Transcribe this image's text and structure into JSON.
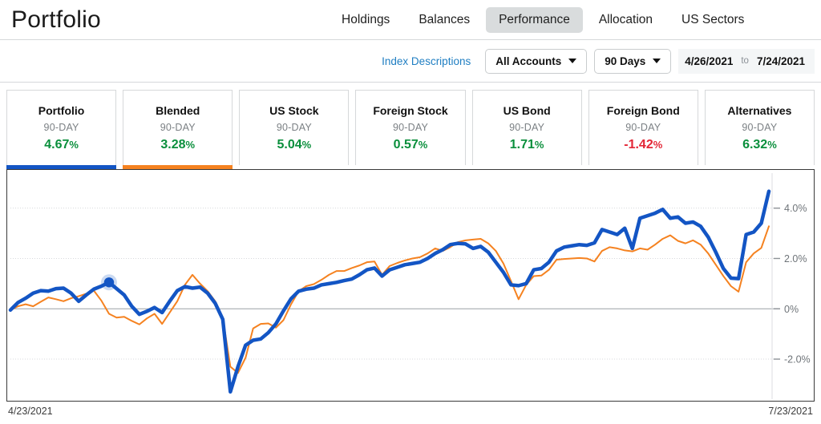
{
  "header": {
    "title": "Portfolio",
    "tabs": [
      {
        "label": "Holdings",
        "active": false
      },
      {
        "label": "Balances",
        "active": false
      },
      {
        "label": "Performance",
        "active": true
      },
      {
        "label": "Allocation",
        "active": false
      },
      {
        "label": "US Sectors",
        "active": false
      }
    ]
  },
  "toolbar": {
    "index_descriptions": "Index Descriptions",
    "accounts_filter": "All Accounts",
    "period_filter": "90 Days",
    "date_from": "4/26/2021",
    "date_to_label": "to",
    "date_to": "7/24/2021"
  },
  "cards": [
    {
      "title": "Portfolio",
      "period": "90-DAY",
      "value": "4.67",
      "unit": "%",
      "sign": "pos",
      "selected": true,
      "color": "#1355c4"
    },
    {
      "title": "Blended",
      "period": "90-DAY",
      "value": "3.28",
      "unit": "%",
      "sign": "pos",
      "selected": true,
      "color": "#f58220"
    },
    {
      "title": "US Stock",
      "period": "90-DAY",
      "value": "5.04",
      "unit": "%",
      "sign": "pos",
      "selected": false,
      "color": ""
    },
    {
      "title": "Foreign Stock",
      "period": "90-DAY",
      "value": "0.57",
      "unit": "%",
      "sign": "pos",
      "selected": false,
      "color": ""
    },
    {
      "title": "US Bond",
      "period": "90-DAY",
      "value": "1.71",
      "unit": "%",
      "sign": "pos",
      "selected": false,
      "color": ""
    },
    {
      "title": "Foreign Bond",
      "period": "90-DAY",
      "value": "-1.42",
      "unit": "%",
      "sign": "neg",
      "selected": false,
      "color": ""
    },
    {
      "title": "Alternatives",
      "period": "90-DAY",
      "value": "6.32",
      "unit": "%",
      "sign": "pos",
      "selected": false,
      "color": ""
    }
  ],
  "chart_data": {
    "type": "line",
    "title": "",
    "xlabel": "",
    "ylabel": "",
    "grid": true,
    "legend_position": "none",
    "x_start_label": "4/23/2021",
    "x_end_label": "7/23/2021",
    "ytick_labels": [
      "4.0%",
      "2.0%",
      "0%",
      "-2.0%"
    ],
    "ytick_values": [
      4.0,
      2.0,
      0.0,
      -2.0
    ],
    "ylim": [
      -3.4,
      5.2
    ],
    "hover_point": {
      "series": "Portfolio",
      "index": 13,
      "value": 1.05
    },
    "series": [
      {
        "name": "Portfolio",
        "color": "#1355c4",
        "width": 4.5,
        "values": [
          -0.05,
          0.25,
          0.42,
          0.62,
          0.72,
          0.7,
          0.8,
          0.82,
          0.62,
          0.3,
          0.55,
          0.78,
          0.9,
          1.05,
          0.8,
          0.55,
          0.1,
          -0.22,
          -0.1,
          0.05,
          -0.15,
          0.3,
          0.72,
          0.88,
          0.82,
          0.86,
          0.62,
          0.22,
          -0.42,
          -3.3,
          -2.3,
          -1.45,
          -1.25,
          -1.2,
          -0.95,
          -0.6,
          -0.08,
          0.4,
          0.7,
          0.78,
          0.82,
          0.95,
          1.0,
          1.05,
          1.12,
          1.18,
          1.35,
          1.55,
          1.62,
          1.3,
          1.55,
          1.65,
          1.75,
          1.8,
          1.85,
          2.0,
          2.2,
          2.35,
          2.55,
          2.6,
          2.58,
          2.4,
          2.48,
          2.25,
          1.85,
          1.45,
          0.95,
          0.92,
          1.0,
          1.55,
          1.6,
          1.85,
          2.3,
          2.45,
          2.5,
          2.55,
          2.52,
          2.62,
          3.15,
          3.05,
          2.95,
          3.2,
          2.4,
          3.6,
          3.7,
          3.8,
          3.95,
          3.6,
          3.65,
          3.4,
          3.45,
          3.28,
          2.85,
          2.25,
          1.6,
          1.22,
          1.2,
          2.95,
          3.05,
          3.4,
          4.67
        ]
      },
      {
        "name": "Blended",
        "color": "#f58220",
        "width": 2,
        "values": [
          -0.05,
          0.1,
          0.18,
          0.1,
          0.28,
          0.45,
          0.38,
          0.3,
          0.42,
          0.5,
          0.6,
          0.72,
          0.32,
          -0.2,
          -0.35,
          -0.32,
          -0.48,
          -0.62,
          -0.38,
          -0.2,
          -0.6,
          -0.15,
          0.3,
          0.95,
          1.35,
          1.0,
          0.7,
          0.3,
          -0.35,
          -2.3,
          -2.55,
          -1.95,
          -0.78,
          -0.6,
          -0.58,
          -0.75,
          -0.45,
          0.18,
          0.7,
          0.9,
          0.98,
          1.15,
          1.35,
          1.5,
          1.5,
          1.62,
          1.72,
          1.85,
          1.88,
          1.35,
          1.7,
          1.82,
          1.92,
          2.0,
          2.05,
          2.2,
          2.4,
          2.3,
          2.45,
          2.65,
          2.72,
          2.75,
          2.78,
          2.6,
          2.3,
          1.8,
          1.1,
          0.38,
          0.95,
          1.3,
          1.32,
          1.55,
          1.95,
          1.98,
          2.0,
          2.02,
          2.0,
          1.88,
          2.3,
          2.45,
          2.4,
          2.32,
          2.28,
          2.4,
          2.35,
          2.55,
          2.78,
          2.92,
          2.7,
          2.6,
          2.72,
          2.55,
          2.2,
          1.75,
          1.3,
          0.9,
          0.68,
          1.85,
          2.2,
          2.42,
          3.28
        ]
      }
    ]
  }
}
